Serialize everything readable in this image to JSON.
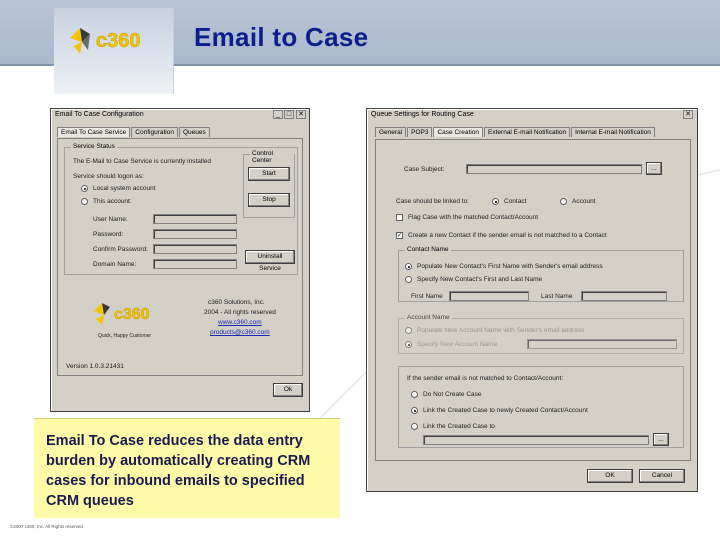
{
  "slide": {
    "title": "Email to Case",
    "logo_text": "c360",
    "caption": "Email To Case reduces the data entry burden by automatically creating CRM cases for inbound emails to specified CRM queues",
    "footer": "©2007 c360, Inc. All Rights reserved."
  },
  "dialog1": {
    "title": "Email To Case Configuration",
    "close": "✕",
    "tabs": [
      "Email To Case Service",
      "Configuration",
      "Queues"
    ],
    "group_service": "Service Status",
    "status_text": "The E-Mail to Case Service is currently installed",
    "logon_label": "Service should logon as:",
    "radio_local": "Local system account",
    "radio_this": "This account:",
    "user_name": "User Name:",
    "password": "Password:",
    "confirm_password": "Confirm Password:",
    "domain_name": "Domain Name:",
    "control_center": "Control Center",
    "start": "Start",
    "stop": "Stop",
    "uninstall": "Uninstall Service",
    "logo_sub": "Quick, Happy Customer",
    "company": "c360 Solutions, Inc.",
    "rights": "2004 - All rights reserved",
    "web": "www.c360.com",
    "email": "products@c360.com",
    "version": "Version 1.0.3.21431",
    "ok": "Ok"
  },
  "dialog2": {
    "title": "Queue Settings for Routing Case",
    "close": "✕",
    "tabs": [
      "General",
      "POP3",
      "Case Creation",
      "External E-mail Notification",
      "Internal E-mail Notification"
    ],
    "case_subject": "Case Subject:",
    "browse": "...",
    "linked_to": "Case should be linked to:",
    "radio_contact": "Contact",
    "radio_account": "Account",
    "flag_case": "Flag Case with the matched Contact/Account",
    "create_contact": "Create a new Contact if the sender email is not matched to a Contact",
    "contact_name_group": "Contact Name",
    "populate_contact": "Populate New Contact's First Name with Sender's email address",
    "specify_contact": "Specify New Contact's First and Last Name",
    "first_name": "First Name",
    "last_name": "Last Name",
    "account_name_group": "Account Name",
    "populate_account": "Populate New Account Name with Sender's email address",
    "specify_account": "Specify New Account Name",
    "not_matched_label": "If the sender email is not matched to Contact/Account:",
    "do_not_create": "Do Not Create Case",
    "link_created": "Link the Created Case to newly Created Contact/Account",
    "link_to": "Link the Created Case to",
    "ok": "OK",
    "cancel": "Cancel"
  }
}
